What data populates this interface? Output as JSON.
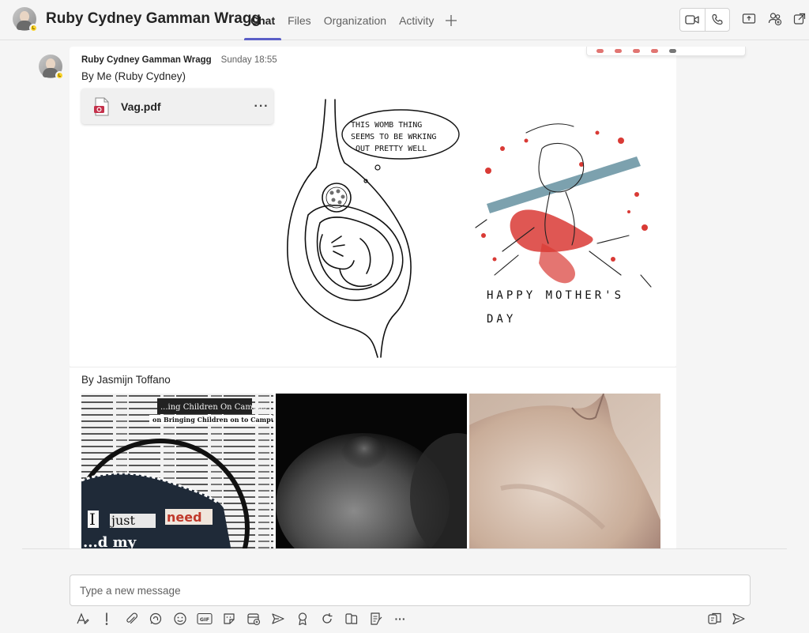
{
  "header": {
    "title": "Ruby Cydney Gamman Wragg",
    "tabs": [
      {
        "label": "Chat",
        "active": true
      },
      {
        "label": "Files",
        "active": false
      },
      {
        "label": "Organization",
        "active": false
      },
      {
        "label": "Activity",
        "active": false
      }
    ],
    "add_tab_label": "+",
    "icons": [
      "video-call-icon",
      "audio-call-icon",
      "share-screen-icon",
      "add-people-icon",
      "pop-out-icon"
    ]
  },
  "colors": {
    "accent": "#5b5fc7",
    "presence_away": "#f8d22a",
    "pdf_red": "#c4314b"
  },
  "messages": [
    {
      "sender": "Ruby Cydney Gamman Wragg",
      "time": "Sunday 18:55",
      "text": "By Me (Ruby Cydney)",
      "attachment": {
        "name": "Vag.pdf",
        "more_label": "···"
      },
      "images": [
        {
          "caption_lines": [
            "THIS WOMB THING",
            "SEEMS TO BE WRKING",
            "OUT PRETTY WELL"
          ]
        },
        {
          "caption_lines": [
            "HAPPY  MOTHER'S",
            "DAY"
          ]
        }
      ]
    },
    {
      "text": "By Jasmijn Toffano",
      "images": [
        {
          "headline": "...ing Children On Campus",
          "subhead": "on Bringing Children on to Campus",
          "words": [
            "I",
            "just",
            "need"
          ],
          "words2": "...d my"
        },
        {
          "subject": "blurred close-up photo"
        },
        {
          "subject": "plaster sculpture photo"
        }
      ]
    }
  ],
  "compose": {
    "placeholder": "Type a new message",
    "toolbar": [
      "format-icon",
      "important-icon",
      "attach-icon",
      "loop-icon",
      "emoji-icon",
      "gif-icon",
      "sticker-icon",
      "schedule-meeting-icon",
      "send-praise-icon",
      "praise-icon",
      "loop-component-icon",
      "approvals-icon",
      "forms-icon",
      "more-options-icon"
    ],
    "gif_label": "GIF",
    "more_label": "···"
  }
}
